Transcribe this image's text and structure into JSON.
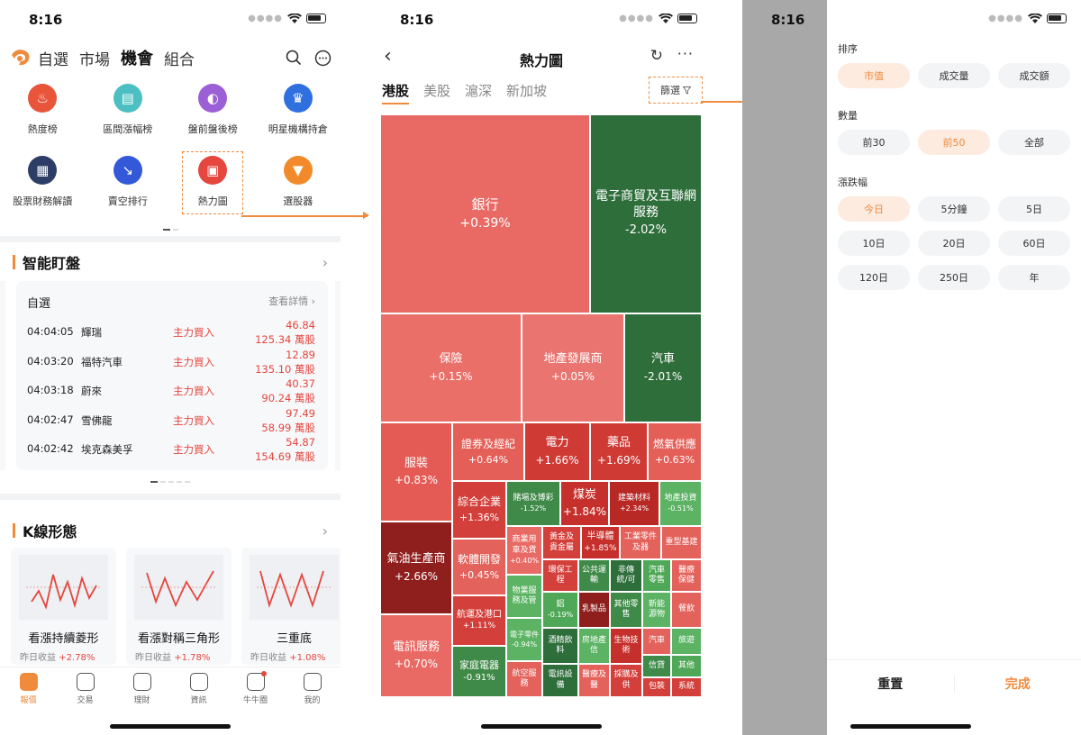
{
  "status_time": "8:16",
  "screen1": {
    "tabs": [
      {
        "label": "自選",
        "active": false
      },
      {
        "label": "市場",
        "active": false
      },
      {
        "label": "機會",
        "active": true
      },
      {
        "label": "組合",
        "active": false
      }
    ],
    "shortcuts": [
      {
        "label": "熱度榜",
        "icon": "flame-icon",
        "color": "#e8553b"
      },
      {
        "label": "區間漲幅榜",
        "icon": "range-icon",
        "color": "#4bbfc2"
      },
      {
        "label": "盤前盤後榜",
        "icon": "clock-icon",
        "color": "#9b5fd6"
      },
      {
        "label": "明星機構持倉",
        "icon": "crown-icon",
        "color": "#2f6fe0"
      },
      {
        "label": "股票財務解讀",
        "icon": "report-icon",
        "color": "#2d3e66"
      },
      {
        "label": "賣空排行",
        "icon": "short-icon",
        "color": "#3459d8"
      },
      {
        "label": "熱力圖",
        "icon": "heatmap-icon",
        "color": "#e5463e",
        "highlight": true
      },
      {
        "label": "選股器",
        "icon": "funnel-icon",
        "color": "#f28a2c"
      }
    ],
    "smart_monitor": {
      "title": "智能盯盤",
      "card_title": "自選",
      "card_more": "查看詳情",
      "rows": [
        {
          "time": "04:04:05",
          "name": "輝瑞",
          "action": "主力買入",
          "price": "46.84",
          "volume": "125.34 萬股"
        },
        {
          "time": "04:03:20",
          "name": "福特汽車",
          "action": "主力買入",
          "price": "12.89",
          "volume": "135.10 萬股"
        },
        {
          "time": "04:03:18",
          "name": "蔚來",
          "action": "主力買入",
          "price": "40.37",
          "volume": "90.24 萬股"
        },
        {
          "time": "04:02:47",
          "name": "雪佛龍",
          "action": "主力買入",
          "price": "97.49",
          "volume": "58.99 萬股"
        },
        {
          "time": "04:02:42",
          "name": "埃克森美孚",
          "action": "主力買入",
          "price": "54.87",
          "volume": "154.69 萬股"
        }
      ]
    },
    "kline": {
      "title": "K線形態",
      "cards": [
        {
          "name": "看漲持續菱形",
          "yield_label": "昨日收益",
          "yield": "+2.78%"
        },
        {
          "name": "看漲對稱三角形",
          "yield_label": "昨日收益",
          "yield": "+1.78%"
        },
        {
          "name": "三重底",
          "yield_label": "昨日收益",
          "yield": "+1.08%"
        }
      ]
    },
    "tabbar": [
      {
        "label": "報價",
        "icon": "chart-icon",
        "active": true
      },
      {
        "label": "交易",
        "icon": "trade-icon",
        "active": false
      },
      {
        "label": "理財",
        "icon": "piggy-icon",
        "active": false
      },
      {
        "label": "資訊",
        "icon": "news-icon",
        "active": false
      },
      {
        "label": "牛牛圈",
        "icon": "community-icon",
        "active": false,
        "dot": true
      },
      {
        "label": "我的",
        "icon": "profile-icon",
        "active": false
      }
    ]
  },
  "screen2": {
    "title": "熱力圖",
    "market_tabs": [
      {
        "label": "港股",
        "active": true
      },
      {
        "label": "美股",
        "active": false
      },
      {
        "label": "滬深",
        "active": false
      },
      {
        "label": "新加坡",
        "active": false
      }
    ],
    "filter_label": "篩選",
    "treemap": [
      {
        "name": "銀行",
        "change": "+0.39%",
        "color": "#e96a64"
      },
      {
        "name": "電子商貿及互聯網服務",
        "change": "-2.02%",
        "color": "#2e6e3b"
      },
      {
        "name": "保險",
        "change": "+0.15%",
        "color": "#ea6f69"
      },
      {
        "name": "地產發展商",
        "change": "+0.05%",
        "color": "#ea7570"
      },
      {
        "name": "汽車",
        "change": "-2.01%",
        "color": "#2e6e3b"
      },
      {
        "name": "服裝",
        "change": "+0.83%",
        "color": "#e45a54"
      },
      {
        "name": "證券及經紀",
        "change": "+0.64%",
        "color": "#e45f58"
      },
      {
        "name": "電力",
        "change": "+1.66%",
        "color": "#cf3a35"
      },
      {
        "name": "藥品",
        "change": "+1.69%",
        "color": "#cf3a35"
      },
      {
        "name": "燃氣供應",
        "change": "+0.63%",
        "color": "#e45f58"
      },
      {
        "name": "綜合企業",
        "change": "+1.36%",
        "color": "#d33f3a"
      },
      {
        "name": "賭場及博彩",
        "change": "-1.52%",
        "color": "#3f8a48"
      },
      {
        "name": "煤炭",
        "change": "+1.84%",
        "color": "#c6302c"
      },
      {
        "name": "建築材料",
        "change": "+2.34%",
        "color": "#b82825"
      },
      {
        "name": "地產投資",
        "change": "-0.51%",
        "color": "#5bb363"
      },
      {
        "name": "氣油生產商",
        "change": "+2.66%",
        "color": "#8e1f1d"
      },
      {
        "name": "軟體開發",
        "change": "+0.45%",
        "color": "#e4625c"
      },
      {
        "name": "商業用車及貨",
        "change": "+0.40%",
        "color": "#e86a64"
      },
      {
        "name": "黃金及貴金屬",
        "change": "",
        "color": "#d33f3a"
      },
      {
        "name": "半導體",
        "change": "+1.85%",
        "color": "#c6302c"
      },
      {
        "name": "工業零件及器",
        "change": "",
        "color": "#e4625c"
      },
      {
        "name": "重型基建",
        "change": "",
        "color": "#e4625c"
      },
      {
        "name": "環保工程",
        "change": "",
        "color": "#d33f3a"
      },
      {
        "name": "公共運輸",
        "change": "",
        "color": "#3f8a48"
      },
      {
        "name": "非傳統/可",
        "change": "",
        "color": "#2e6e3b"
      },
      {
        "name": "汽車零售",
        "change": "",
        "color": "#4fa857"
      },
      {
        "name": "醫療保健",
        "change": "",
        "color": "#e4625c"
      },
      {
        "name": "物業服務及管",
        "change": "",
        "color": "#5bb363"
      },
      {
        "name": "航運及港口",
        "change": "+1.11%",
        "color": "#d33f3a"
      },
      {
        "name": "鋁",
        "change": "-0.19%",
        "color": "#4fa857"
      },
      {
        "name": "乳製品",
        "change": "",
        "color": "#8e1f1d"
      },
      {
        "name": "其他零售",
        "change": "",
        "color": "#3f8a48"
      },
      {
        "name": "新能源物",
        "change": "",
        "color": "#5bb363"
      },
      {
        "name": "餐飲",
        "change": "",
        "color": "#e4625c"
      },
      {
        "name": "電子零件",
        "change": "-0.94%",
        "color": "#5bb363"
      },
      {
        "name": "酒精飲料",
        "change": "",
        "color": "#2e6e3b"
      },
      {
        "name": "房地產信",
        "change": "",
        "color": "#5bb363"
      },
      {
        "name": "生物技術",
        "change": "",
        "color": "#c6302c"
      },
      {
        "name": "汽車",
        "change": "",
        "color": "#e4625c"
      },
      {
        "name": "旅遊",
        "change": "",
        "color": "#5bb363"
      },
      {
        "name": "電訊服務",
        "change": "+0.70%",
        "color": "#e96a64"
      },
      {
        "name": "家庭電器",
        "change": "-0.91%",
        "color": "#3f8a48"
      },
      {
        "name": "航空服務",
        "change": "",
        "color": "#e4625c"
      },
      {
        "name": "電訊設備",
        "change": "",
        "color": "#2e6e3b"
      },
      {
        "name": "醫療及醫",
        "change": "",
        "color": "#e4625c"
      },
      {
        "name": "採購及供",
        "change": "",
        "color": "#d33f3a"
      },
      {
        "name": "信貸",
        "change": "",
        "color": "#3f8a48"
      },
      {
        "name": "其他",
        "change": "",
        "color": "#4fa857"
      },
      {
        "name": "包裝",
        "change": "",
        "color": "#d33f3a"
      },
      {
        "name": "系統",
        "change": "",
        "color": "#d33f3a"
      }
    ]
  },
  "screen3": {
    "groups": [
      {
        "title": "排序",
        "options": [
          {
            "label": "市值",
            "active": true
          },
          {
            "label": "成交量",
            "active": false
          },
          {
            "label": "成交額",
            "active": false
          }
        ]
      },
      {
        "title": "數量",
        "options": [
          {
            "label": "前30",
            "active": false
          },
          {
            "label": "前50",
            "active": true
          },
          {
            "label": "全部",
            "active": false
          }
        ]
      },
      {
        "title": "漲跌幅",
        "options": [
          {
            "label": "今日",
            "active": true
          },
          {
            "label": "5分鐘",
            "active": false
          },
          {
            "label": "5日",
            "active": false
          },
          {
            "label": "10日",
            "active": false
          },
          {
            "label": "20日",
            "active": false
          },
          {
            "label": "60日",
            "active": false
          },
          {
            "label": "120日",
            "active": false
          },
          {
            "label": "250日",
            "active": false
          },
          {
            "label": "年",
            "active": false
          }
        ]
      }
    ],
    "reset_label": "重置",
    "done_label": "完成"
  }
}
